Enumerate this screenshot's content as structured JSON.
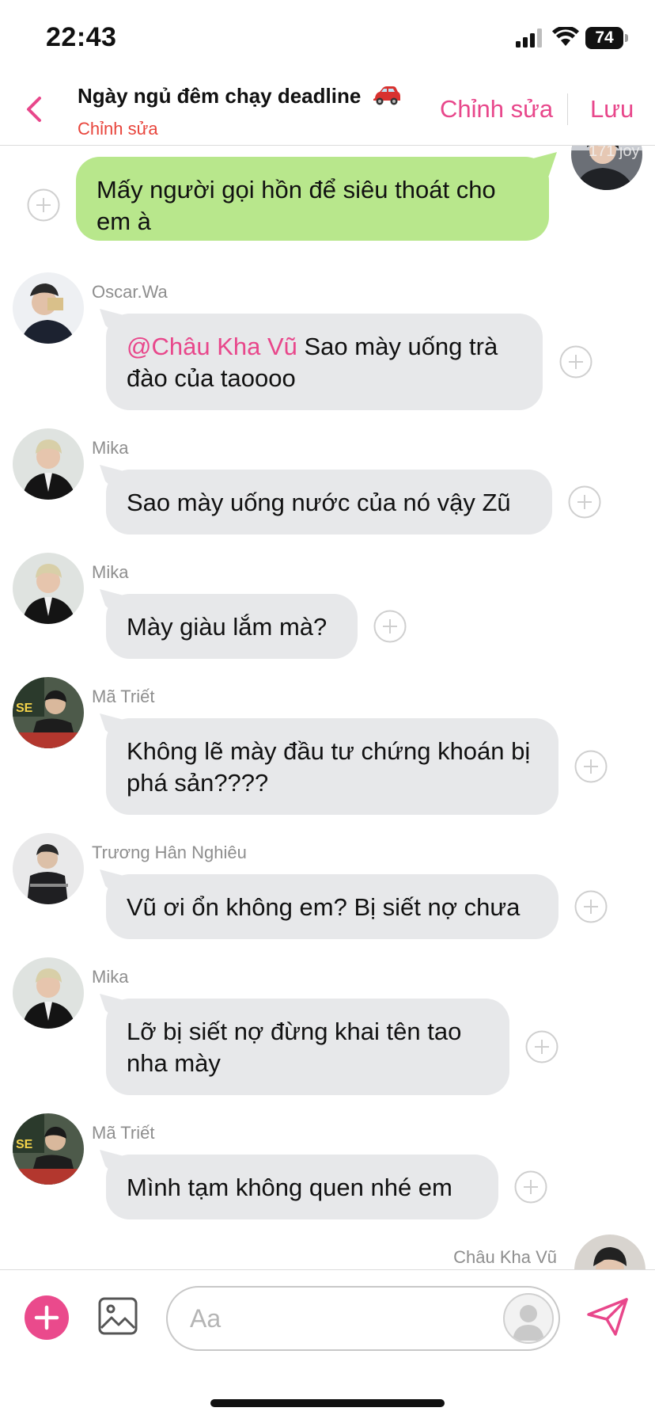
{
  "status_bar": {
    "time": "22:43",
    "battery": "74"
  },
  "header": {
    "title": "Ngày ngủ đêm chạy deadline",
    "title_emoji": "car-icon",
    "subtitle": "Chỉnh sửa",
    "edit_label": "Chỉnh sửa",
    "save_label": "Lưu"
  },
  "messages": [
    {
      "sender": "",
      "text": "Mấy người gọi hồn để siêu thoát cho em à",
      "mine": true,
      "avatar_overlay": "171 joy"
    },
    {
      "sender": "Oscar.Wa",
      "mention": "@Châu Kha Vũ",
      "text": " Sao mày uống trà đào của taoooo"
    },
    {
      "sender": "Mika",
      "text": "Sao mày uống nước của nó vậy Zũ"
    },
    {
      "sender": "Mika",
      "text": "Mày giàu lắm mà?"
    },
    {
      "sender": "Mã Triết",
      "text": "Không lẽ mày đầu tư chứng khoán bị phá sản????"
    },
    {
      "sender": "Trương Hân Nghiêu",
      "text": "Vũ ơi ổn không em? Bị siết nợ chưa"
    },
    {
      "sender": "Mika",
      "text": "Lỡ bị siết nợ đừng khai tên tao nha mày"
    },
    {
      "sender": "Mã Triết",
      "text": "Mình tạm không quen nhé em"
    },
    {
      "sender": "Châu Kha Vũ",
      "text": ""
    }
  ],
  "input": {
    "placeholder": "Aa"
  },
  "colors": {
    "accent": "#e8478b",
    "subtitle": "#e8453c",
    "bubble_in": "#e7e8ea",
    "bubble_out": "#b8e78c"
  }
}
